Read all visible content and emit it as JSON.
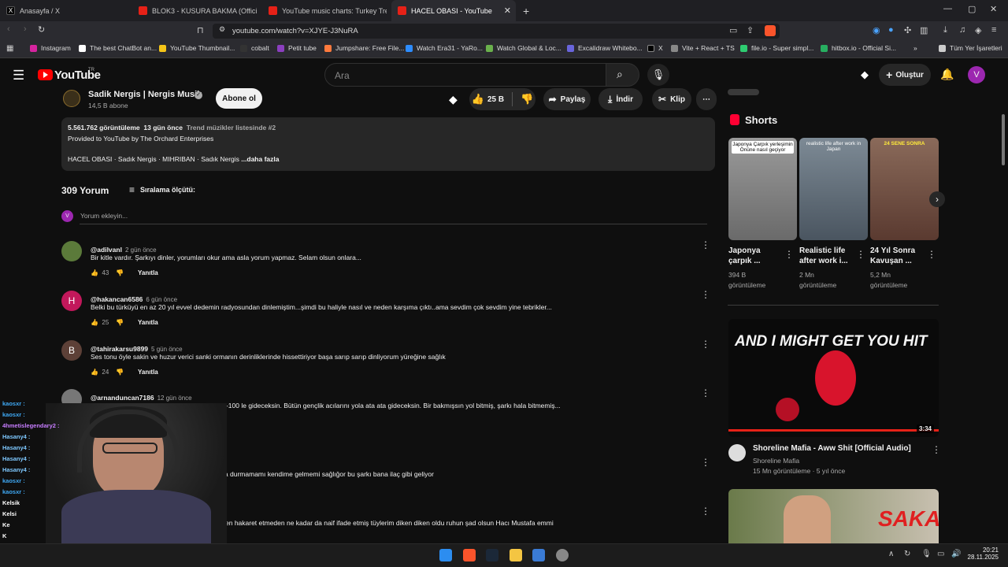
{
  "tabs": [
    {
      "label": "Anasayfa / X",
      "color": "#000000"
    },
    {
      "label": "BLOK3 - KUSURA BAKMA (Official M",
      "color": "#e62117"
    },
    {
      "label": "YouTube music charts: Turkey Trendi",
      "color": "#e62117"
    },
    {
      "label": "HACEL OBASI - YouTube",
      "color": "#e62117"
    }
  ],
  "address": "youtube.com/watch?v=XJYE-J3NuRA",
  "bookmarks": [
    "Instagram",
    "The best ChatBot an...",
    "YouTube Thumbnail...",
    "cobalt",
    "Petit tube",
    "Jumpshare: Free File...",
    "Watch Era31 - YaRo...",
    "Watch Global & Loc...",
    "Excalidraw Whitebo...",
    "X",
    "Vite + React + TS",
    "file.io - Super simpl...",
    "hitbox.io - Official Si..."
  ],
  "bookmark_folder": "Tüm Yer İşaretleri",
  "yt": {
    "logo": "YouTube",
    "region": "TR",
    "search_placeholder": "Ara",
    "create": "Oluştur",
    "avatar": "V"
  },
  "channel": {
    "name": "Sadik Nergis | Nergis Musik",
    "subs": "14,5 B abone",
    "subscribe": "Abone ol"
  },
  "actions": {
    "likes": "25 B",
    "share": "Paylaş",
    "download": "İndir",
    "clip": "Klip"
  },
  "desc": {
    "views": "5.561.762 görüntüleme",
    "age": "13 gün önce",
    "trend": "Trend müzikler listesinde #2",
    "line2": "Provided to YouTube by The Orchard Enterprises",
    "tags": "HACEL OBASI · Sadık Nergis · MIHRIBAN · Sadık Nergis",
    "more": "...daha fazla"
  },
  "comments_header": {
    "count": "309 Yorum",
    "sort": "Sıralama ölçütü:",
    "add": "Yorum ekleyin..."
  },
  "comments": [
    {
      "handle": "@adilvanl",
      "age": "2 gün önce",
      "text": "Bir kitle vardır. Şarkıyı dinler, yorumları okur ama asla yorum yapmaz. Selam olsun onlara...",
      "likes": "43",
      "reply": "Yanıtla",
      "initial": "",
      "color": "#5b7a3a"
    },
    {
      "handle": "@hakancan6586",
      "age": "6 gün önce",
      "text": "Belki bu türküyü en az 20 yıl evvel dedemin radyosundan dinlemiştim...şimdi bu haliyle nasıl ve neden karşıma çıktı..ama sevdim çok sevdim yine tebrikler...",
      "likes": "25",
      "reply": "Yanıtla",
      "initial": "H",
      "color": "#c2185b"
    },
    {
      "handle": "@tahirakarsu9899",
      "age": "5 gün önce",
      "text": "Ses tonu öyle sakin ve huzur verici sanki ormanın derinliklerinde hissettiriyor başa sarıp sarıp dinliyorum yüreğine sağlık",
      "likes": "24",
      "reply": "Yanıtla",
      "initial": "B",
      "color": "#5d4037"
    },
    {
      "handle": "@arnanduncan7186",
      "age": "12 gün önce",
      "text": "Gece yolculuğuna çıkacaksın bu müzik ile. 90-100 le gideceksin. Bütün gençlik acılarını yola ata ata gideceksin. Bir bakmışsın yol bitmiş, şarkı hala bitmemiş...",
      "likes": "",
      "reply": "Yanıtla",
      "initial": "",
      "color": "#777777"
    }
  ],
  "partial_comments": [
    "k ayakta durmamamı kendime gelmemi sağlığor bu şarkı bana ilaç gibi geliyor",
    "en hakaret etmeden ne kadar da naif ifade etmiş tüylerim diken diken oldu ruhun şad olsun Hacı Mustafa emmi"
  ],
  "shorts": {
    "title": "Shorts",
    "items": [
      {
        "title": "Japonya çarpık ...",
        "views": "394 B",
        "unit": "görüntüleme",
        "thumb_text": "Japonya Çarpık yerleşimin Önüne nasıl geçiyor",
        "bg": "#8a8a8a"
      },
      {
        "title": "Realistic life after work i...",
        "views": "2 Mn",
        "unit": "görüntüleme",
        "thumb_text": "realistic life after work in Japan",
        "bg": "#6e7c88"
      },
      {
        "title": "24 Yıl Sonra Kavuşan ...",
        "views": "5,2 Mn",
        "unit": "görüntüleme",
        "thumb_text": "24 SENE SONRA",
        "bg": "#7a5a4a"
      }
    ]
  },
  "video1": {
    "title": "Shoreline Mafia - Aww Shit [Official Audio]",
    "channel": "Shoreline Mafia",
    "meta": "15 Mn görüntüleme · 5 yıl önce",
    "duration": "3:34",
    "thumb_text": "AND I MIGHT GET YOU HIT"
  },
  "video2": {
    "thumb_text": "SAKAT"
  },
  "chat": [
    {
      "name": "kaosxr :",
      "color": "#3fa9f5"
    },
    {
      "name": "kaosxr :",
      "color": "#3fa9f5"
    },
    {
      "name": "4hmetislegendary2 :",
      "color": "#c77dff"
    },
    {
      "name": "Hasany4 :",
      "color": "#7ec8ff"
    },
    {
      "name": "Hasany4 :",
      "color": "#7ec8ff"
    },
    {
      "name": "Hasany4 :",
      "color": "#7ec8ff"
    },
    {
      "name": "Hasany4 :",
      "color": "#7ec8ff"
    },
    {
      "name": "kaosxr :",
      "color": "#3fa9f5"
    },
    {
      "name": "kaosxr :",
      "color": "#3fa9f5"
    },
    {
      "name": "Kelsik",
      "color": "#ffffff"
    },
    {
      "name": "Kelsi",
      "color": "#ffffff"
    },
    {
      "name": "Ke",
      "color": "#ffffff"
    },
    {
      "name": "K",
      "color": "#ffffff"
    },
    {
      "name": "4",
      "color": "#ff9f43"
    }
  ],
  "clock": {
    "time": "20:21",
    "date": "28.11.2025"
  }
}
